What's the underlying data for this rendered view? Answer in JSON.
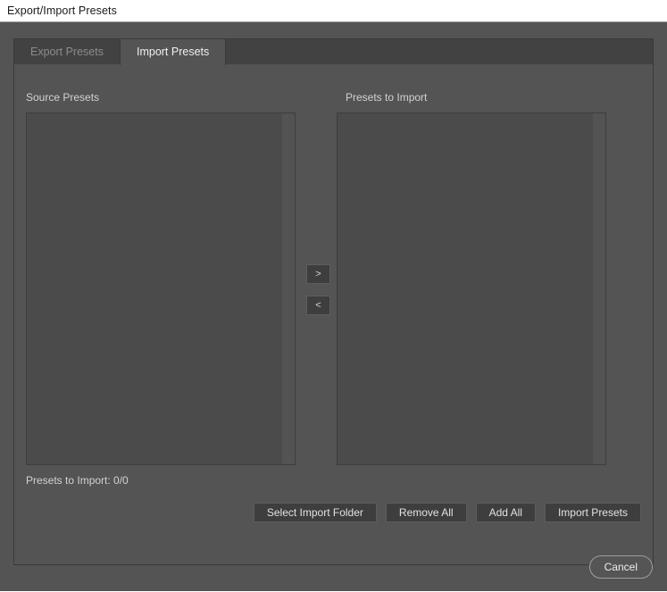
{
  "window": {
    "title": "Export/Import Presets"
  },
  "tabs": [
    {
      "label": "Export Presets",
      "active": false
    },
    {
      "label": "Import Presets",
      "active": true
    }
  ],
  "panel": {
    "source_presets": {
      "label": "Source Presets",
      "items": []
    },
    "presets_to_import": {
      "label": "Presets to Import",
      "items": []
    },
    "transfer": {
      "move_right_label": ">",
      "move_left_label": "<"
    },
    "status": {
      "presets_count": "Presets to Import: 0/0"
    },
    "actions": [
      {
        "label": "Select Import Folder"
      },
      {
        "label": "Remove All"
      },
      {
        "label": "Add All"
      },
      {
        "label": "Import Presets"
      }
    ]
  },
  "footer": {
    "cancel_label": "Cancel"
  },
  "colors": {
    "title_bar_bg": "#ffffff",
    "title_text": "#1a1a1a",
    "dialog_bg": "#545454",
    "tab_strip_bg": "#424242",
    "tab_active_bg": "#545454",
    "tab_inactive_text": "#8c8c8c",
    "tab_active_text": "#f0f0f0",
    "list_box_bg": "#4b4b4b",
    "list_box_border": "#3d3d3d",
    "button_bg": "#3e3e3e",
    "button_border": "#5c5c5c",
    "button_text": "#e2e2e2",
    "cancel_border": "#9d9d9d"
  }
}
